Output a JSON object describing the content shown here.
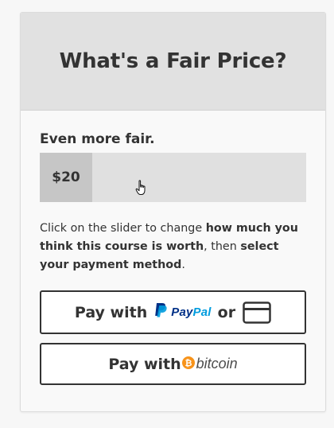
{
  "header": {
    "title": "What's a Fair Price?"
  },
  "pricing": {
    "fairness_label": "Even more fair.",
    "slider_value": "$20",
    "slider_fraction": 0.197
  },
  "instructions": {
    "part1": "Click on the slider to change ",
    "bold1": "how much you think this course is worth",
    "part2": ", then ",
    "bold2": "select your payment method",
    "part3": "."
  },
  "buttons": {
    "paypal": {
      "prefix": "Pay with",
      "brand_pay": "Pay",
      "brand_pal": "Pal",
      "or": "or"
    },
    "bitcoin": {
      "prefix": "Pay with",
      "brand": "bitcoin"
    }
  },
  "colors": {
    "header_bg": "#e1e1e1",
    "slider_track": "#e0e0e0",
    "slider_fill": "#c6c6c6",
    "text": "#333333",
    "paypal_dark": "#003087",
    "paypal_light": "#009cde",
    "bitcoin_orange": "#f7931a"
  },
  "icons": [
    "hand-pointer-icon",
    "paypal-p-icon",
    "credit-card-icon",
    "bitcoin-icon"
  ]
}
